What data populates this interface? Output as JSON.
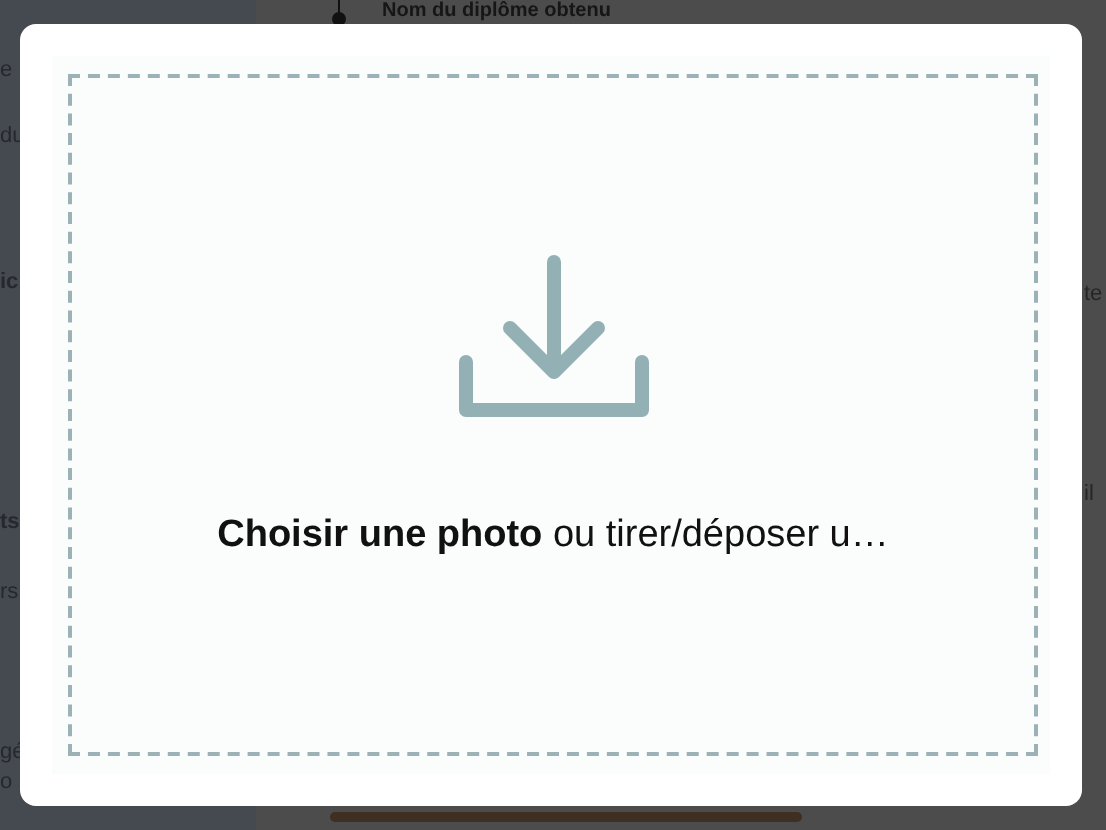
{
  "background": {
    "heading": "Nom du diplôme obtenu",
    "left_fragments": [
      {
        "text": "e",
        "bold": false
      },
      {
        "text": "du",
        "bold": false
      },
      {
        "text": "ic",
        "bold": true
      },
      {
        "text": "ts",
        "bold": true
      },
      {
        "text": "rs",
        "bold": false
      },
      {
        "text": "gé",
        "bold": false
      },
      {
        "text": "o",
        "bold": false
      }
    ],
    "right_fragments": [
      "te",
      "il"
    ]
  },
  "dialog": {
    "prompt": "**Choisir une photo** ou tirer/déposer u…"
  }
}
